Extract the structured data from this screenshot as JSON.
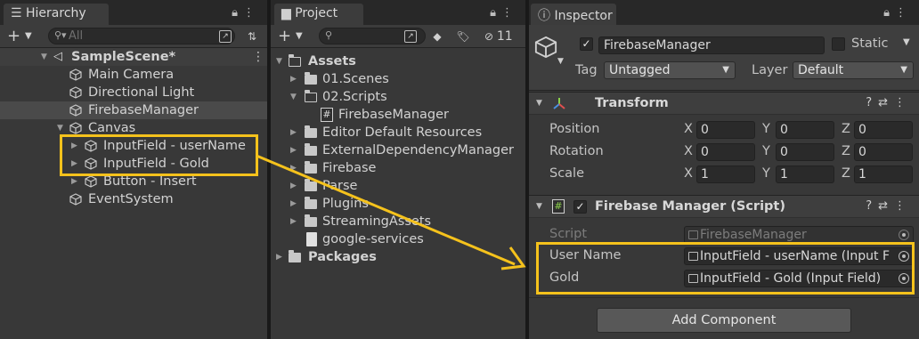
{
  "colors": {
    "highlight": "#f5c21c",
    "panel_bg": "#383838",
    "selection": "#4a4a4a"
  },
  "hierarchy": {
    "tab_label": "Hierarchy",
    "search_placeholder": "All",
    "scene_name": "SampleScene*",
    "items": [
      {
        "label": "Main Camera"
      },
      {
        "label": "Directional Light"
      },
      {
        "label": "FirebaseManager"
      },
      {
        "label": "Canvas"
      },
      {
        "label": "InputField - userName"
      },
      {
        "label": "InputField - Gold"
      },
      {
        "label": "Button - Insert"
      },
      {
        "label": "EventSystem"
      }
    ]
  },
  "project": {
    "tab_label": "Project",
    "hidden_count": "11",
    "items": [
      {
        "label": "Assets"
      },
      {
        "label": "01.Scenes"
      },
      {
        "label": "02.Scripts"
      },
      {
        "label": "FirebaseManager"
      },
      {
        "label": "Editor Default Resources"
      },
      {
        "label": "ExternalDependencyManager"
      },
      {
        "label": "Firebase"
      },
      {
        "label": "Parse"
      },
      {
        "label": "Plugins"
      },
      {
        "label": "StreamingAssets"
      },
      {
        "label": "google-services"
      },
      {
        "label": "Packages"
      }
    ]
  },
  "inspector": {
    "tab_label": "Inspector",
    "object_name": "FirebaseManager",
    "static_label": "Static",
    "tag_label": "Tag",
    "tag_value": "Untagged",
    "layer_label": "Layer",
    "layer_value": "Default",
    "transform": {
      "title": "Transform",
      "rows": [
        {
          "label": "Position",
          "x": "0",
          "y": "0",
          "z": "0"
        },
        {
          "label": "Rotation",
          "x": "0",
          "y": "0",
          "z": "0"
        },
        {
          "label": "Scale",
          "x": "1",
          "y": "1",
          "z": "1"
        }
      ],
      "axis_x": "X",
      "axis_y": "Y",
      "axis_z": "Z"
    },
    "script_component": {
      "title": "Firebase Manager (Script)",
      "script_label": "Script",
      "script_value": "FirebaseManager",
      "user_name_label": "User Name",
      "user_name_value": "InputField - userName (Input F",
      "gold_label": "Gold",
      "gold_value": "InputField - Gold (Input Field)"
    },
    "add_component_label": "Add Component"
  }
}
